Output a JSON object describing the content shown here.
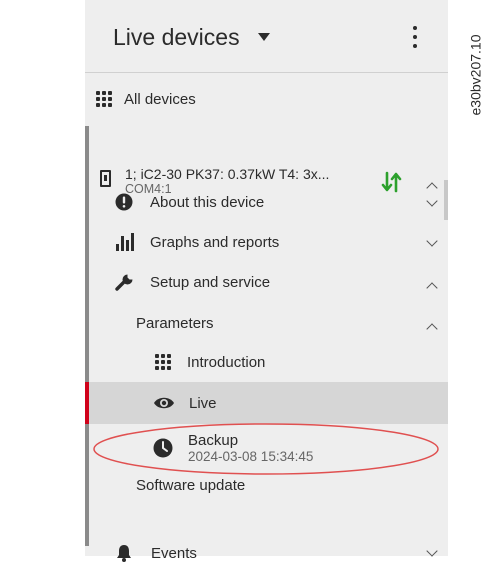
{
  "header": {
    "title": "Live devices"
  },
  "nav": {
    "all_devices": "All devices"
  },
  "device": {
    "name": "1; iC2-30 PK37: 0.37kW T4: 3x...",
    "connection": "COM4:1",
    "status_color": "#2ca02c"
  },
  "menu": {
    "about": "About this device",
    "graphs": "Graphs and reports",
    "setup": "Setup and service",
    "parameters": "Parameters",
    "introduction": "Introduction",
    "live": "Live",
    "backup_label": "Backup",
    "backup_time": "2024-03-08 15:34:45",
    "software_update": "Software update",
    "events": "Events"
  },
  "figure_code": "e30bv207.10",
  "colors": {
    "active_marker": "#d0021b",
    "highlight_ellipse": "#e05050",
    "panel_bg": "#eeeeee"
  }
}
